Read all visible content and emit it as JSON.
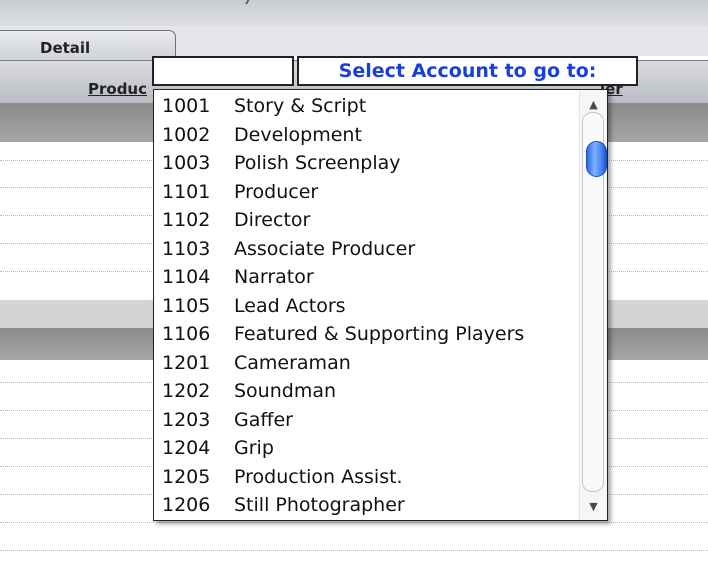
{
  "tab": {
    "label": "Detail"
  },
  "columns": {
    "left": "Produc",
    "right": "ier"
  },
  "dropdown": {
    "search_value": "",
    "go_label": "Select Account to go to:",
    "items": [
      {
        "code": "1001",
        "name": "Story & Script"
      },
      {
        "code": "1002",
        "name": "Development"
      },
      {
        "code": "1003",
        "name": "Polish Screenplay"
      },
      {
        "code": "1101",
        "name": "Producer"
      },
      {
        "code": "1102",
        "name": "Director"
      },
      {
        "code": "1103",
        "name": "Associate Producer"
      },
      {
        "code": "1104",
        "name": "Narrator"
      },
      {
        "code": "1105",
        "name": "Lead Actors"
      },
      {
        "code": "1106",
        "name": "Featured & Supporting Players"
      },
      {
        "code": "1201",
        "name": "Cameraman"
      },
      {
        "code": "1202",
        "name": "Soundman"
      },
      {
        "code": "1203",
        "name": "Gaffer"
      },
      {
        "code": "1204",
        "name": "Grip"
      },
      {
        "code": "1205",
        "name": "Production Assist."
      },
      {
        "code": "1206",
        "name": "Still Photographer"
      }
    ],
    "scroll_position": 0.08,
    "icons": {
      "up": "scroll-up-arrow-icon",
      "down": "scroll-down-arrow-icon"
    }
  },
  "colors": {
    "accent_text": "#1a3fd9",
    "scroll_thumb": "#2b6be6"
  }
}
